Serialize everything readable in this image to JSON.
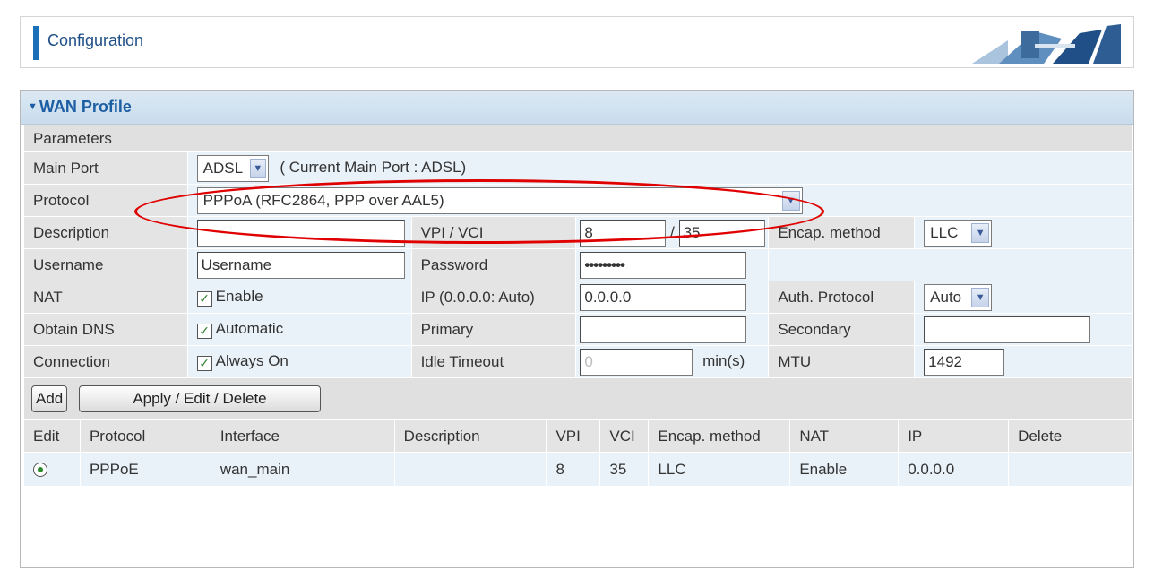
{
  "header": {
    "title": "Configuration"
  },
  "panel": {
    "title": "WAN Profile"
  },
  "params": {
    "section_label": "Parameters",
    "main_port": {
      "label": "Main Port",
      "value": "ADSL",
      "current_note": "( Current Main Port : ADSL)"
    },
    "protocol": {
      "label": "Protocol",
      "value": "PPPoA (RFC2864, PPP over AAL5)"
    },
    "description": {
      "label": "Description",
      "value": ""
    },
    "vpi_vci": {
      "label": "VPI / VCI",
      "vpi": "8",
      "separator": "/",
      "vci": "35"
    },
    "encap": {
      "label": "Encap. method",
      "value": "LLC"
    },
    "username": {
      "label": "Username",
      "value": "Username"
    },
    "password": {
      "label": "Password",
      "value": "•••••••••"
    },
    "nat": {
      "label": "NAT",
      "checkbox_label": "Enable"
    },
    "ip": {
      "label": "IP (0.0.0.0: Auto)",
      "value": "0.0.0.0"
    },
    "auth_protocol": {
      "label": "Auth. Protocol",
      "value": "Auto"
    },
    "obtain_dns": {
      "label": "Obtain DNS",
      "checkbox_label": "Automatic"
    },
    "primary": {
      "label": "Primary",
      "value": ""
    },
    "secondary": {
      "label": "Secondary",
      "value": ""
    },
    "connection": {
      "label": "Connection",
      "checkbox_label": "Always On"
    },
    "idle_timeout": {
      "label": "Idle Timeout",
      "value": "0",
      "unit": "min(s)"
    },
    "mtu": {
      "label": "MTU",
      "value": "1492"
    }
  },
  "buttons": {
    "add": "Add",
    "apply": "Apply / Edit / Delete"
  },
  "table": {
    "headers": [
      "Edit",
      "Protocol",
      "Interface",
      "Description",
      "VPI",
      "VCI",
      "Encap. method",
      "NAT",
      "IP",
      "Delete"
    ],
    "rows": [
      {
        "protocol": "PPPoE",
        "interface": "wan_main",
        "description": "",
        "vpi": "8",
        "vci": "35",
        "encap": "LLC",
        "nat": "Enable",
        "ip": "0.0.0.0",
        "delete": ""
      }
    ]
  },
  "colors": {
    "accent": "#1a6fb8",
    "title_blue": "#1e5fa4",
    "annotation": "#e00000"
  }
}
